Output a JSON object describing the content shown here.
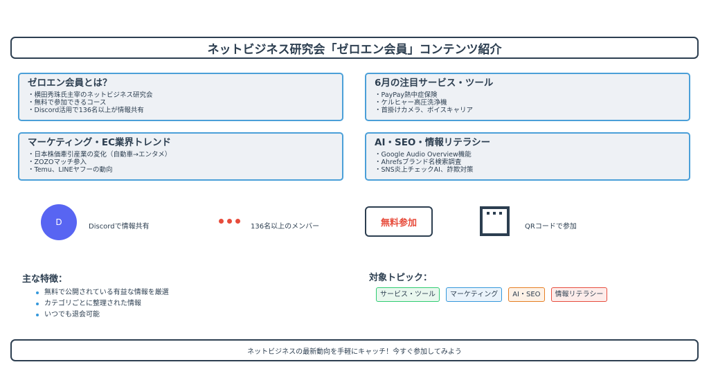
{
  "header": {
    "title": "ネットビジネス研究会「ゼロエン会員」コンテンツ紹介"
  },
  "cards": [
    {
      "title": "ゼロエン会員とは？",
      "lines": [
        "横田秀珠氏主宰のネットビジネス研究会",
        "無料で参加できるコース",
        "Discord活用で136名以上が情報共有"
      ]
    },
    {
      "title": "6月の注目サービス・ツール",
      "lines": [
        "PayPay熱中症保険",
        "ケルヒャー高圧洗浄機",
        "首掛けカメラ、ボイスキャリア"
      ]
    },
    {
      "title": "マーケティング・EC業界トレンド",
      "lines": [
        "日本株価牽引産業の変化（自動車→エンタメ）",
        "ZOZOマッチ参入",
        "Temu、LINEヤフーの動向"
      ]
    },
    {
      "title": "AI・SEO・情報リテラシー",
      "lines": [
        "Google Audio Overview機能",
        "Ahrefsブランド名検索調査",
        "SNS炎上チェックAI、詐欺対策"
      ]
    }
  ],
  "highlights": {
    "discord_letter": "D",
    "discord_label": "Discordで情報共有",
    "members_label": "136名以上のメンバー",
    "free_button": "無料参加",
    "qr_label": "QRコードで参加"
  },
  "features": {
    "title": "主な特徴：",
    "items": [
      "無料で公開されている有益な情報を厳選",
      "カテゴリごとに整理された情報",
      "いつでも退会可能"
    ]
  },
  "topics": {
    "title": "対象トピック：",
    "tags": [
      "サービス・ツール",
      "マーケティング",
      "AI・SEO",
      "情報リテラシー"
    ]
  },
  "footer": {
    "text": "ネットビジネスの最新動向を手軽にキャッチ！今すぐ参加してみよう"
  },
  "colors": {
    "primary": "#2c3e50",
    "accent_blue": "#4a9fd8",
    "accent_red": "#e74c3c",
    "discord": "#5865f2"
  },
  "icons": {
    "discord": "discord-icon",
    "members": "dots-icon",
    "qr": "qr-code-icon"
  }
}
